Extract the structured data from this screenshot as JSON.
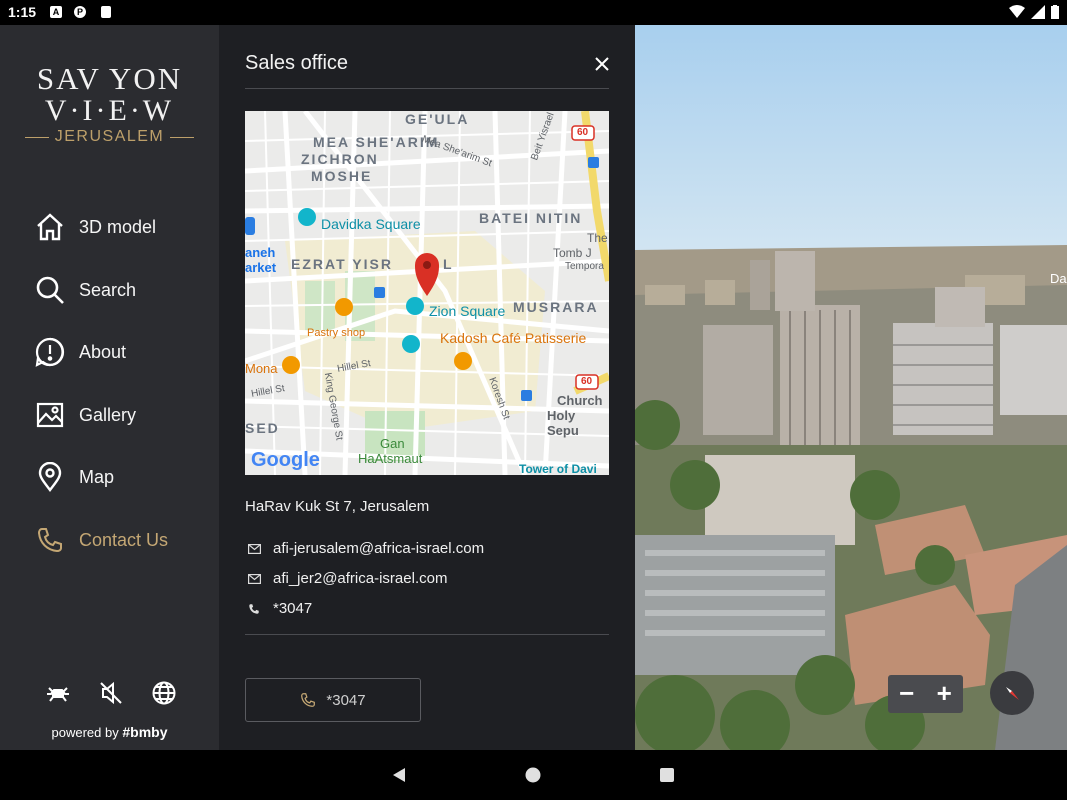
{
  "status_bar": {
    "time": "1:15",
    "icons": [
      "a-icon",
      "p-icon",
      "sd-icon",
      "wifi-icon",
      "signal-icon",
      "battery-icon"
    ]
  },
  "logo": {
    "line1": "SAV YON",
    "line2": "V·I·E·W",
    "line3": "JERUSALEM"
  },
  "sidebar": {
    "items": [
      {
        "label": "3D model",
        "icon": "home-icon"
      },
      {
        "label": "Search",
        "icon": "search-icon"
      },
      {
        "label": "About",
        "icon": "info-icon"
      },
      {
        "label": "Gallery",
        "icon": "gallery-icon"
      },
      {
        "label": "Map",
        "icon": "map-pin-icon"
      },
      {
        "label": "Contact Us",
        "icon": "phone-icon",
        "active": true
      }
    ],
    "bottom_icons": [
      "drone-icon",
      "mute-icon",
      "globe-icon"
    ],
    "powered_by": "powered by",
    "brand": "#bmby"
  },
  "panel": {
    "title": "Sales office",
    "address": "HaRav Kuk St 7, Jerusalem",
    "email1": "afi-jerusalem@africa-israel.com",
    "email2": "afi_jer2@africa-israel.com",
    "phone": "*3047",
    "call_button": "*3047"
  },
  "map": {
    "labels": {
      "geula": "GE'ULA",
      "mea": "MEA SHE'ARIM",
      "zichron1": "ZICHRON",
      "zichron2": "MOSHE",
      "batei": "BATEI NITIN",
      "davidka": "Davidka Square",
      "mahaneh1": "aneh",
      "mahaneh2": "arket",
      "ezrat": "EZRAT YISR",
      "ezrat2": "L",
      "zion": "Zion Square",
      "musrara": "MUSRARA",
      "pastry": "Pastry shop",
      "kadosh": "Kadosh Café Patisserie",
      "mona": "Mona",
      "tomb1": "The",
      "tomb2": "Tomb J",
      "tomb3": "Tempora",
      "church1": "Church",
      "church2": "Holy Sepu",
      "sed": "SED",
      "gan1": "Gan",
      "gan2": "HaAtsmaut",
      "tower": "Tower of Davi",
      "hillel1": "Hillel St",
      "hillel2": "Hillel St",
      "king": "King George St",
      "koresh": "Koresh St",
      "meash_st": "Mea She'arim St",
      "bethei": "Beit Yisrael",
      "route": "60",
      "route2": "60",
      "google": "Google"
    }
  },
  "scene": {
    "side_label": "Da",
    "zoom_out": "−",
    "zoom_in": "+"
  },
  "colors": {
    "sidebar_bg": "#2b2c30",
    "panel_bg": "#1e1f23",
    "accent": "#c4a774"
  }
}
